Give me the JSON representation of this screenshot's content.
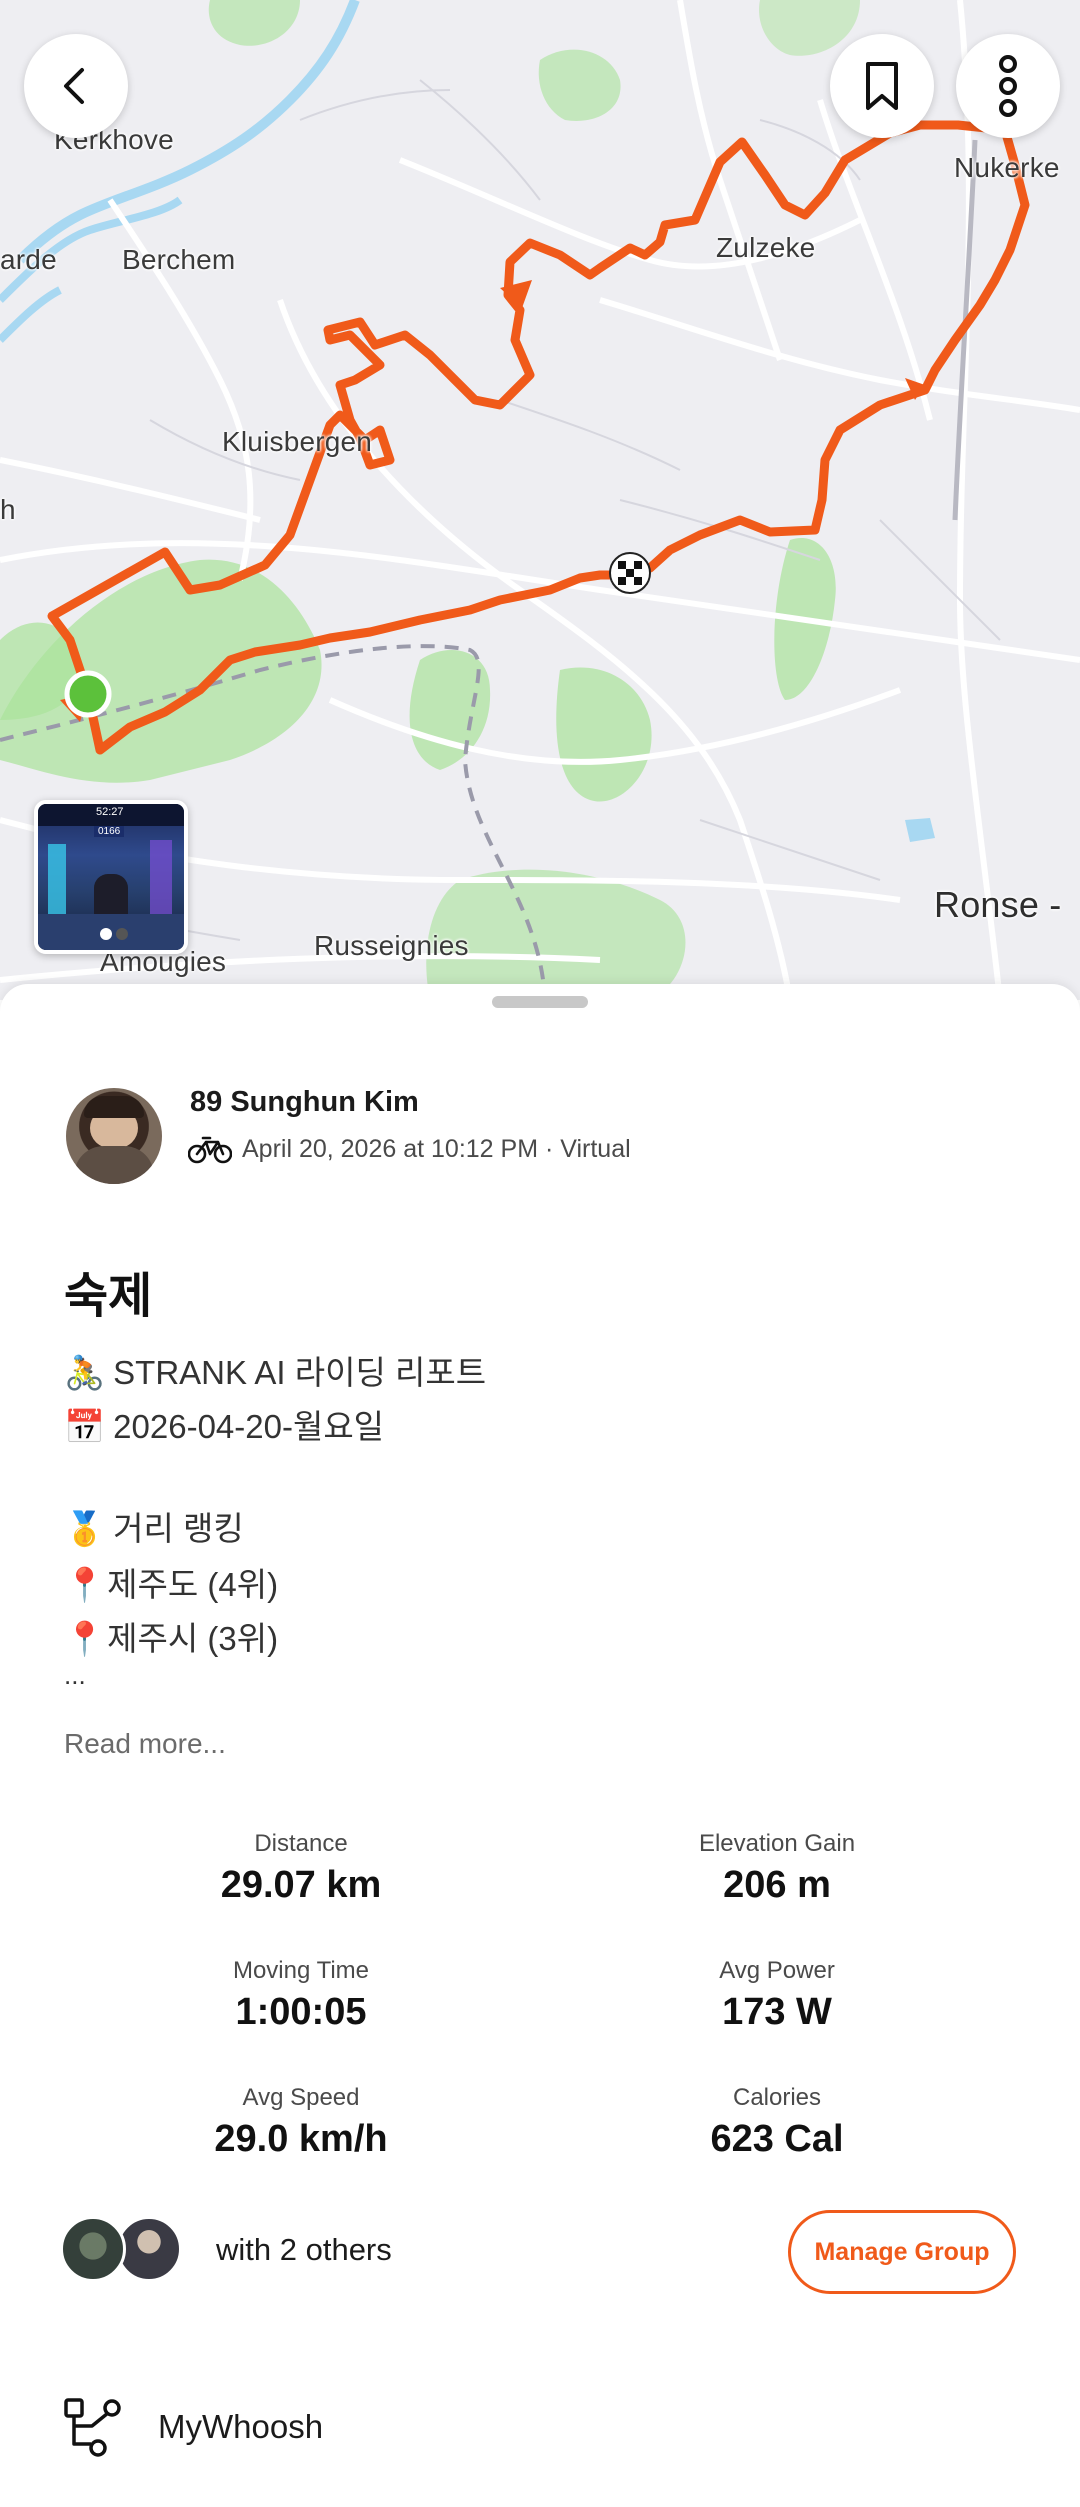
{
  "map": {
    "labels": {
      "kerkhove": "Kerkhove",
      "arde": "arde",
      "berchem": "Berchem",
      "kluisbergen": "Kluisbergen",
      "zulzeke": "Zulzeke",
      "nukerke": "Nukerke",
      "h": "h",
      "ronse": "Ronse -",
      "russeignies": "Russeignies",
      "amougies": "Amougies"
    },
    "route_color": "#f05a1a",
    "start_color": "#5cc13b",
    "thumbnail": {
      "time": "52:27",
      "stats": "0166",
      "pages": 2,
      "active_page": 1
    }
  },
  "toolbar": {
    "back_icon": "chevron-left-icon",
    "bookmark_icon": "bookmark-icon",
    "more_icon": "more-vertical-icon"
  },
  "activity": {
    "athlete_name": "89 Sunghun Kim",
    "meta": "April 20, 2026 at 10:12 PM · Virtual",
    "sport_icon": "bike-icon",
    "title": "숙제",
    "description_lines": [
      {
        "emoji": "🚴",
        "text": "STRANK AI 라이딩 리포트"
      },
      {
        "emoji": "📅",
        "text": "2026-04-20-월요일"
      },
      {
        "emoji": "🥇",
        "text": "거리 랭킹"
      },
      {
        "emoji": "📍",
        "text": "제주도 (4위)"
      },
      {
        "emoji": "📍",
        "text": "제주시 (3위)"
      },
      {
        "emoji": "",
        "text": "..."
      }
    ],
    "read_more": "Read more..."
  },
  "stats": [
    {
      "label": "Distance",
      "value": "29.07 km"
    },
    {
      "label": "Elevation Gain",
      "value": "206 m"
    },
    {
      "label": "Moving Time",
      "value": "1:00:05"
    },
    {
      "label": "Avg Power",
      "value": "173 W"
    },
    {
      "label": "Avg Speed",
      "value": "29.0 km/h"
    },
    {
      "label": "Calories",
      "value": "623 Cal"
    }
  ],
  "group": {
    "with_text": "with 2 others",
    "manage_label": "Manage Group"
  },
  "device": {
    "icon": "device-nodes-icon",
    "name": "MyWhoosh"
  },
  "colors": {
    "accent": "#f05a1a",
    "green": "#5cc13b"
  }
}
